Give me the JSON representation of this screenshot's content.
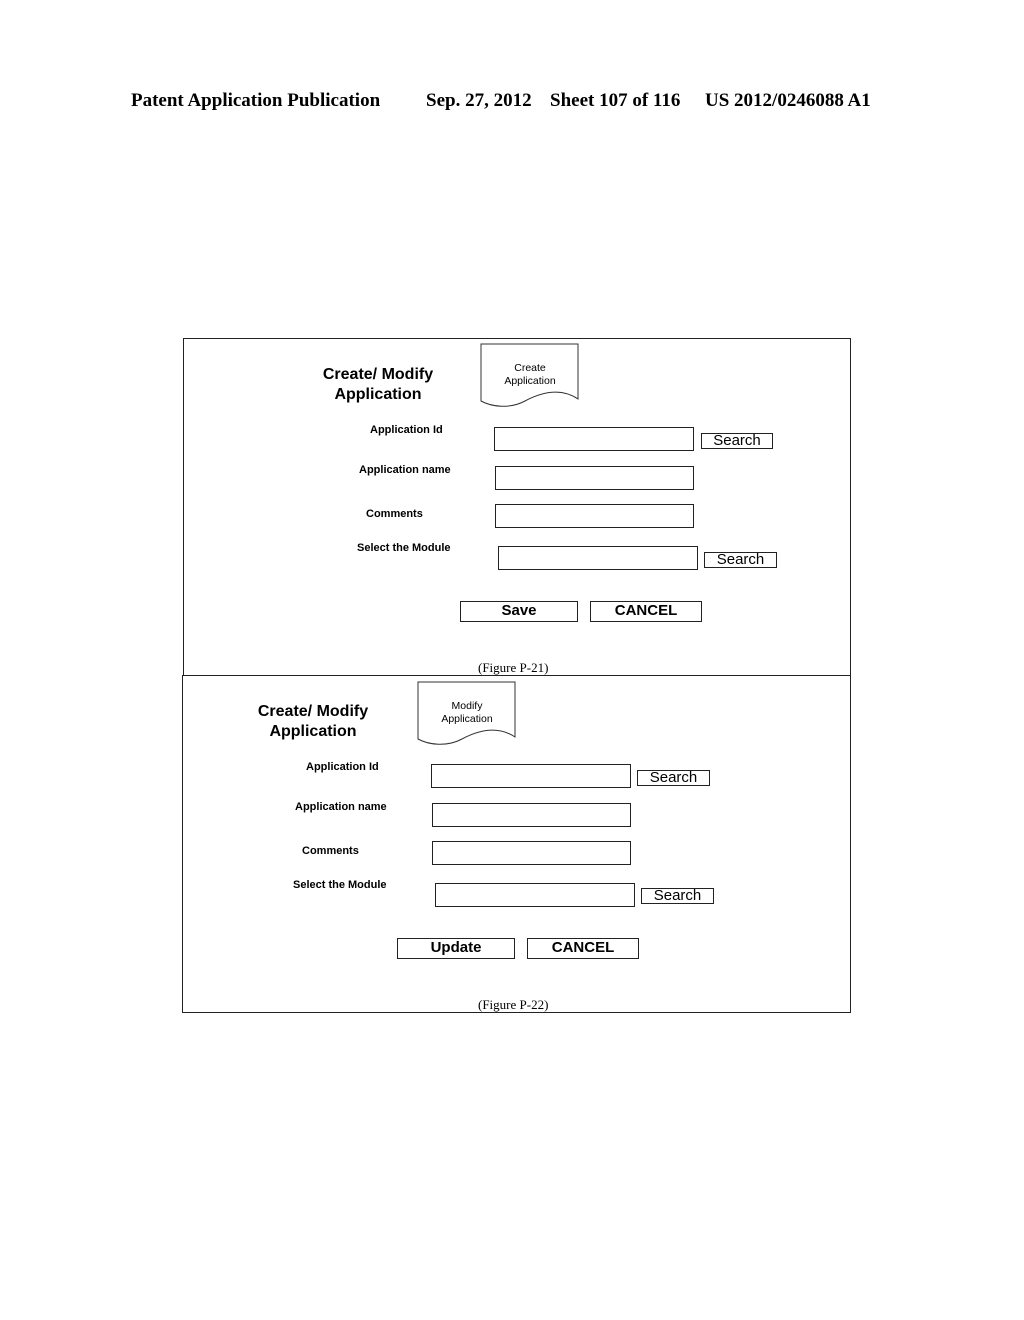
{
  "header": {
    "publication": "Patent Application Publication",
    "date": "Sep. 27, 2012",
    "sheet": "Sheet 107 of 116",
    "number": "US 2012/0246088 A1"
  },
  "figures": [
    {
      "title_line1": "Create/ Modify",
      "title_line2": "Application",
      "doc_line1": "Create",
      "doc_line2": "Application",
      "fields": [
        {
          "label": "Application Id",
          "value": "",
          "search": "Search"
        },
        {
          "label": "Application name",
          "value": ""
        },
        {
          "label": "Comments",
          "value": ""
        },
        {
          "label": "Select the Module",
          "value": "",
          "search": "Search"
        }
      ],
      "primary_button": "Save",
      "cancel_button": "CANCEL",
      "caption": "(Figure P-21)"
    },
    {
      "title_line1": "Create/ Modify",
      "title_line2": "Application",
      "doc_line1": "Modify",
      "doc_line2": "Application",
      "fields": [
        {
          "label": "Application Id",
          "value": "",
          "search": "Search"
        },
        {
          "label": "Application name",
          "value": ""
        },
        {
          "label": "Comments",
          "value": ""
        },
        {
          "label": "Select the Module",
          "value": "",
          "search": "Search"
        }
      ],
      "primary_button": "Update",
      "cancel_button": "CANCEL",
      "caption": "(Figure P-22)"
    }
  ]
}
